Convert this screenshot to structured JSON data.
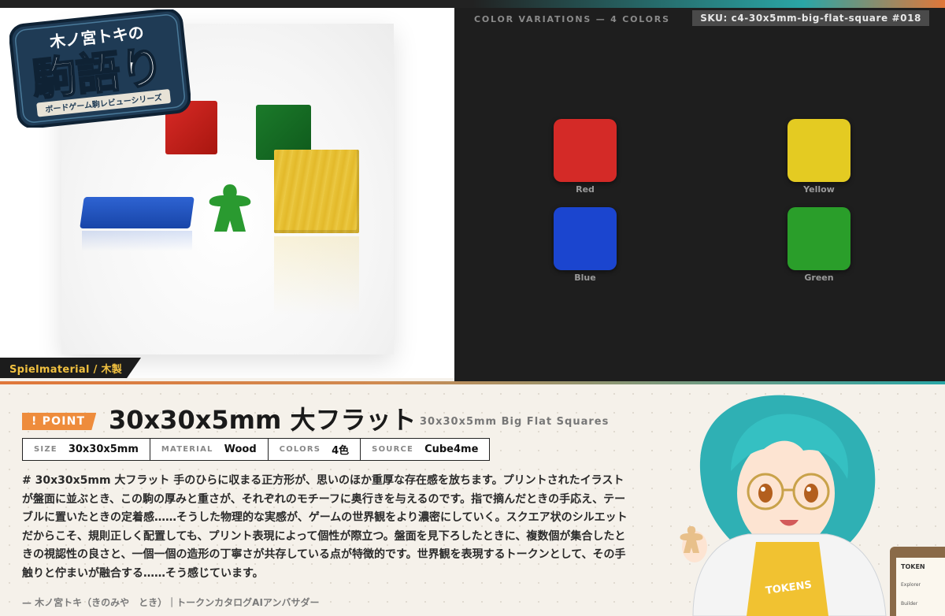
{
  "photo": {
    "tag": "Spielmaterial / 木製"
  },
  "logo": {
    "top": "木ノ宮トキの",
    "main": "駒語り",
    "ribbon": "ボードゲーム駒レビューシリーズ"
  },
  "colors": {
    "title": "COLOR VARIATIONS — 4 COLORS",
    "sku": "SKU: c4-30x5mm-big-flat-square  #018",
    "items": [
      {
        "name": "Red",
        "hex": "#d42a27"
      },
      {
        "name": "Yellow",
        "hex": "#e4cb22"
      },
      {
        "name": "Blue",
        "hex": "#1b45cf"
      },
      {
        "name": "Green",
        "hex": "#2a9e2a"
      }
    ]
  },
  "header": {
    "badge": "! POINT",
    "title": "30x30x5mm 大フラット",
    "subtitle": "30x30x5mm Big Flat Squares"
  },
  "specs": [
    {
      "key": "SIZE",
      "value": "30x30x5mm"
    },
    {
      "key": "MATERIAL",
      "value": "Wood"
    },
    {
      "key": "COLORS",
      "value": "4色"
    },
    {
      "key": "SOURCE",
      "value": "Cube4me"
    }
  ],
  "body": "# 30x30x5mm 大フラット 手のひらに収まる正方形が、思いのほか重厚な存在感を放ちます。プリントされたイラストが盤面に並ぶとき、この駒の厚みと重さが、それぞれのモチーフに奥行きを与えるのです。指で摘んだときの手応え、テーブルに置いたときの定着感……そうした物理的な実感が、ゲームの世界観をより濃密にしていく。スクエア状のシルエットだからこそ、規則正しく配置しても、プリント表現によって個性が際立つ。盤面を見下ろしたときに、複数個が集合したときの視認性の良さと、一個一個の造形の丁寧さが共存している点が特徴的です。世界観を表現するトークンとして、その手触りと佇まいが融合する……そう感じています。",
  "author": "— 木ノ宮トキ（きのみや　とき）｜トークンカタログAIアンバサダー",
  "character": {
    "shirt_text": "TOKENS",
    "board_title": "TOKEN",
    "board_item1": "Explorer",
    "board_item2": "Builder"
  }
}
